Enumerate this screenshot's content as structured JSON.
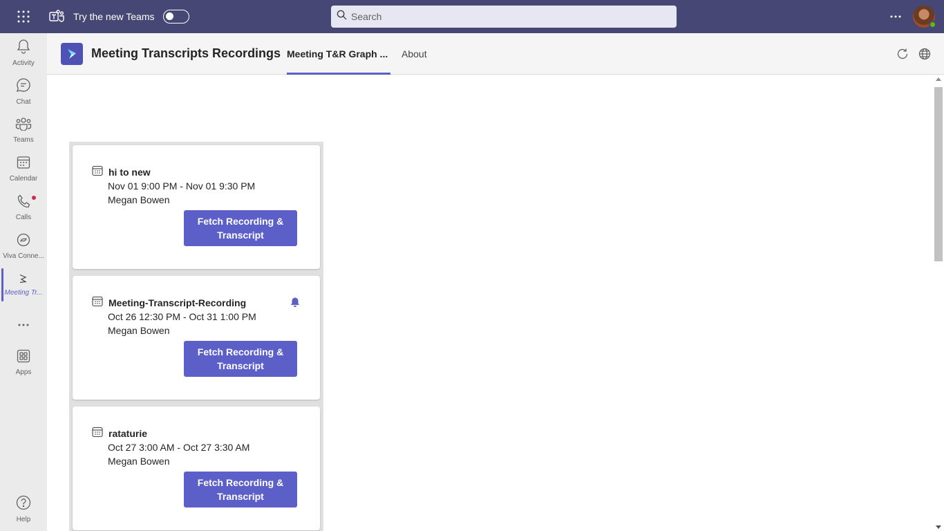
{
  "topbar": {
    "try_new_teams_label": "Try the new Teams",
    "search_placeholder": "Search",
    "more_icon": "more-horizontal-icon"
  },
  "rail": {
    "items": [
      {
        "label": "Activity",
        "icon": "bell-icon"
      },
      {
        "label": "Chat",
        "icon": "chat-icon"
      },
      {
        "label": "Teams",
        "icon": "teams-icon"
      },
      {
        "label": "Calendar",
        "icon": "calendar-icon"
      },
      {
        "label": "Calls",
        "icon": "phone-icon",
        "badge": true
      },
      {
        "label": "Viva Conne...",
        "icon": "viva-connections-icon"
      },
      {
        "label": "Meeting Tr...",
        "icon": "meeting-transcripts-icon",
        "active": true
      },
      {
        "label": "Apps",
        "icon": "apps-icon"
      }
    ],
    "help_label": "Help"
  },
  "app": {
    "title": "Meeting Transcripts Recordings",
    "tabs": [
      {
        "label": "Meeting T&R Graph ...",
        "active": true
      },
      {
        "label": "About",
        "active": false
      }
    ]
  },
  "meetings": [
    {
      "title": "hi to new",
      "time": "Nov 01 9:00 PM - Nov 01 9:30 PM",
      "organizer": "Megan Bowen",
      "button_label": "Fetch Recording & Transcript",
      "notification": false
    },
    {
      "title": "Meeting-Transcript-Recording",
      "time": "Oct 26 12:30 PM - Oct 31 1:00 PM",
      "organizer": "Megan Bowen",
      "button_label": "Fetch Recording & Transcript",
      "notification": true
    },
    {
      "title": "rataturie",
      "time": "Oct 27 3:00 AM - Oct 27 3:30 AM",
      "organizer": "Megan Bowen",
      "button_label": "Fetch Recording & Transcript",
      "notification": false
    }
  ],
  "colors": {
    "topbar": "#464775",
    "accent": "#5b5fc7",
    "rail": "#ebebeb",
    "notification_dot": "#c4314b"
  }
}
